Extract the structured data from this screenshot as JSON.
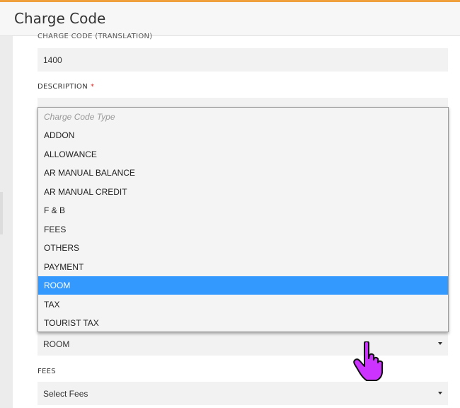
{
  "window": {
    "title": "Charge Code"
  },
  "form": {
    "charge_code_translation_label": "CHARGE CODE (TRANSLATION)",
    "charge_code_translation_value": "1400",
    "description_label": "DESCRIPTION",
    "description_required": "*",
    "charge_code_type_value": "ROOM",
    "fees_label": "FEES",
    "fees_value": "Select Fees"
  },
  "dropdown": {
    "placeholder": "Charge Code Type",
    "options": [
      "ADDON",
      "ALLOWANCE",
      "AR MANUAL BALANCE",
      "AR MANUAL CREDIT",
      "F & B",
      "FEES",
      "OTHERS",
      "PAYMENT",
      "ROOM",
      "TAX",
      "TOURIST TAX"
    ],
    "selected": "ROOM"
  },
  "colors": {
    "accent": "#f0a03c",
    "selected": "#3399ff",
    "required": "#e0322c",
    "cursor": "#cc33ff"
  },
  "icons": {
    "cursor": "hand-pointer-icon",
    "caret": "caret-down-icon"
  }
}
